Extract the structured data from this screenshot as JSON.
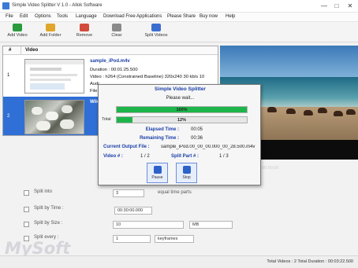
{
  "window": {
    "title": "Simple Video Splitter V 1.0 - Allok Software",
    "controls": [
      "—",
      "□",
      "✕"
    ]
  },
  "menu": [
    "File",
    "Edit",
    "Options",
    "Tools",
    "Language",
    "Download Free Applications",
    "Please Share",
    "Buy now",
    "Help"
  ],
  "toolbar": [
    {
      "label": "Add Video",
      "icon": "add-video-icon",
      "color": "#2a9b3c"
    },
    {
      "label": "Add Folder",
      "icon": "add-folder-icon",
      "color": "#e0a62b"
    },
    {
      "label": "Remove",
      "icon": "remove-icon",
      "color": "#d14a3a"
    },
    {
      "label": "Clear",
      "icon": "clear-icon",
      "color": "#8a8a8a"
    },
    {
      "label": "Split Videos",
      "icon": "split-videos-icon",
      "color": "#3b6fcf"
    }
  ],
  "table": {
    "headers": [
      "#",
      "Video"
    ],
    "rows": [
      {
        "num": "1",
        "name": "sample_iPod.m4v",
        "info": [
          "Duration : 00:01:25.500",
          "Video : h264 (Constrained Baseline) 320x240 30 kb/s 10",
          "Audi",
          "File"
        ]
      },
      {
        "num": "2",
        "name": "Wild",
        "info": []
      }
    ]
  },
  "preview": {
    "time": "00:00:00"
  },
  "dialog": {
    "title": "Simple Video Splitter",
    "wait": "Please wait...",
    "bar1_pct": "100%",
    "bar1_fraction": 1.0,
    "bar2_label": "Total",
    "bar2_pct": "12%",
    "bar2_fraction": 0.12,
    "elapsed_label": "Elapsed Time :",
    "elapsed_value": "00:05",
    "remaining_label": "Remaining Time :",
    "remaining_value": "00:36",
    "output_label": "Current Output File :",
    "output_value": "sample_iPod.00_00_00.000_00_28.500.m4v",
    "video_label": "Video # :",
    "video_value": "1 / 2",
    "part_label": "Split Part # :",
    "part_value": "1 / 3",
    "pause_label": "Pause",
    "stop_label": "Stop"
  },
  "split": {
    "into_label": "Split into",
    "into_value": "3",
    "into_suffix": "equal time parts",
    "time_label": "Split by Time :",
    "time_value": "00:30:00.000",
    "size_label": "Split by Size :",
    "size_value": "10",
    "size_unit": "MB",
    "every_label": "Split every :",
    "every_value": "1",
    "every_unit": "keyframes"
  },
  "status": {
    "text": "Total Videos : 2  Total Duration : 00:03:22.500"
  },
  "watermark": "MySoft"
}
